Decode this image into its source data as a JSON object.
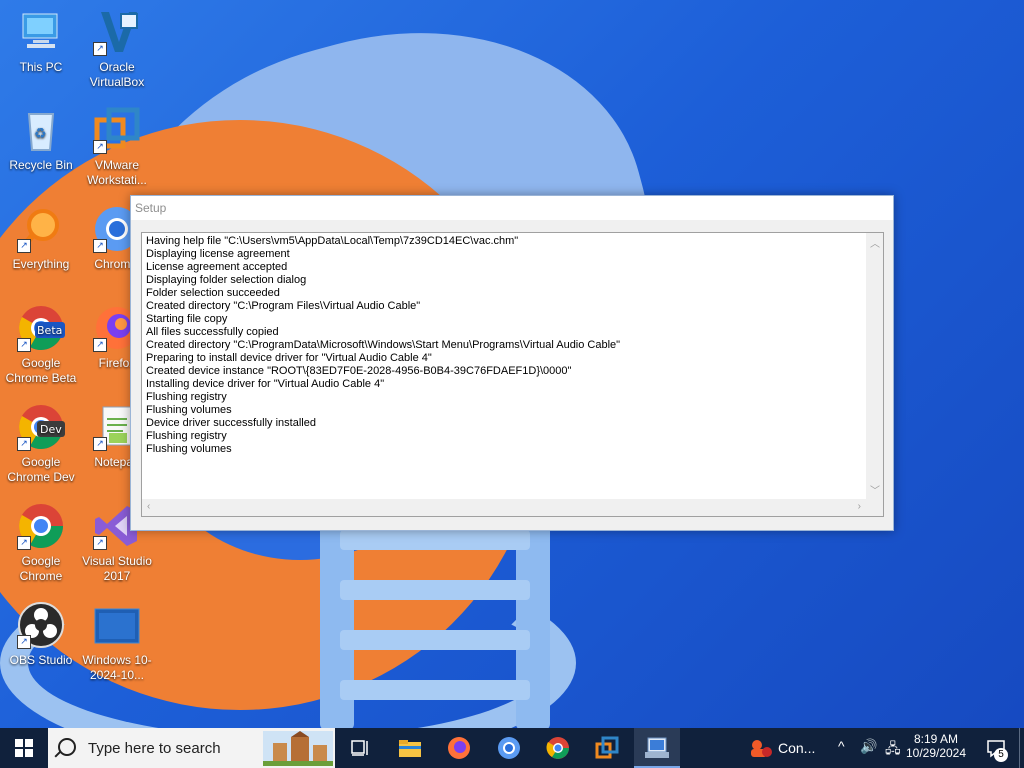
{
  "desktop": {
    "icons": [
      {
        "label": "This PC",
        "icon": "this-pc-icon"
      },
      {
        "label": "Oracle VirtualBox",
        "icon": "virtualbox-icon"
      },
      {
        "label": "Recycle Bin",
        "icon": "recycle-bin-icon"
      },
      {
        "label": "VMware Workstati...",
        "icon": "vmware-icon"
      },
      {
        "label": "Everything",
        "icon": "everything-search-icon"
      },
      {
        "label": "Chromiu",
        "icon": "chromium-icon"
      },
      {
        "label": "Google Chrome Beta",
        "icon": "chrome-beta-icon",
        "badge": "Beta"
      },
      {
        "label": "Firefox",
        "icon": "firefox-icon"
      },
      {
        "label": "Google Chrome Dev",
        "icon": "chrome-dev-icon",
        "badge": "Dev"
      },
      {
        "label": "Notepad",
        "icon": "notepad-icon"
      },
      {
        "label": "Google Chrome",
        "icon": "chrome-icon"
      },
      {
        "label": "Visual Studio 2017",
        "icon": "visual-studio-icon"
      },
      {
        "label": "OBS Studio",
        "icon": "obs-icon"
      },
      {
        "label": "Windows 10-2024-10...",
        "icon": "image-file-icon"
      }
    ]
  },
  "setup": {
    "title": "Setup",
    "log": [
      "Having help file \"C:\\Users\\vm5\\AppData\\Local\\Temp\\7z39CD14EC\\vac.chm\"",
      "Displaying license agreement",
      "License agreement accepted",
      "Displaying folder selection dialog",
      "Folder selection succeeded",
      "Created directory \"C:\\Program Files\\Virtual Audio Cable\"",
      "Starting file copy",
      "All files successfully copied",
      "Created directory \"C:\\ProgramData\\Microsoft\\Windows\\Start Menu\\Programs\\Virtual Audio Cable\"",
      "Preparing to install device driver for \"Virtual Audio Cable 4\"",
      "Created device instance \"ROOT\\{83ED7F0E-2028-4956-B0B4-39C76FDAEF1D}\\0000\"",
      "Installing device driver for \"Virtual Audio Cable 4\"",
      "Flushing registry",
      "Flushing volumes",
      "Device driver successfully installed",
      "Flushing registry",
      "Flushing volumes"
    ]
  },
  "taskbar": {
    "search_placeholder": "Type here to search",
    "pinned": [
      "task-view-icon",
      "file-explorer-icon",
      "firefox-icon",
      "chromium-icon",
      "chrome-dev-icon",
      "vmware-icon",
      "setup-icon"
    ],
    "tray_app_label": "Con...",
    "time": "8:19 AM",
    "date": "10/29/2024",
    "notification_count": "5"
  },
  "colors": {
    "taskbar": "#10213c",
    "wallpaper_blue": "#1f62d6",
    "wallpaper_orange": "#ef7f34"
  }
}
